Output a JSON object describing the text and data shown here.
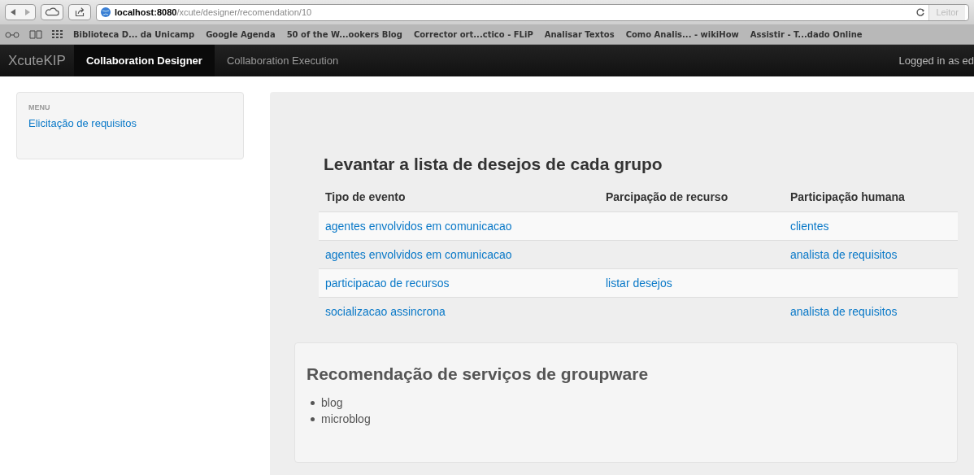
{
  "browser": {
    "url_host": "localhost:8080",
    "url_path": "/xcute/designer/recomendation/10",
    "reader_button": "Leitor",
    "bookmarks": [
      "Biblioteca D... da Unicamp",
      "Google Agenda",
      "50 of the W...ookers Blog",
      "Corrector ort...ctico - FLiP",
      "Analisar Textos",
      "Como Analis... - wikiHow",
      "Assistir - T...dado Online"
    ]
  },
  "navbar": {
    "brand": "XcuteKIP",
    "items": [
      {
        "label": "Collaboration Designer",
        "selected": true
      },
      {
        "label": "Collaboration Execution",
        "selected": false
      }
    ],
    "user": "Logged in as ed"
  },
  "sidebar": {
    "header": "MENU",
    "items": [
      "Elicitação de requisitos"
    ]
  },
  "section": {
    "title": "Levantar a lista de desejos de cada grupo",
    "table": {
      "columns": [
        "Tipo de evento",
        "Parcipação de recurso",
        "Participação humana"
      ],
      "rows": [
        [
          "agentes envolvidos em comunicacao",
          "",
          "clientes"
        ],
        [
          "agentes envolvidos em comunicacao",
          "",
          "analista de requisitos"
        ],
        [
          "participacao de recursos",
          "listar desejos",
          ""
        ],
        [
          "socializacao assincrona",
          "",
          "analista de requisitos"
        ]
      ]
    }
  },
  "recommendation": {
    "title": "Recomendação de serviços de groupware",
    "items": [
      "blog",
      "microblog"
    ]
  }
}
